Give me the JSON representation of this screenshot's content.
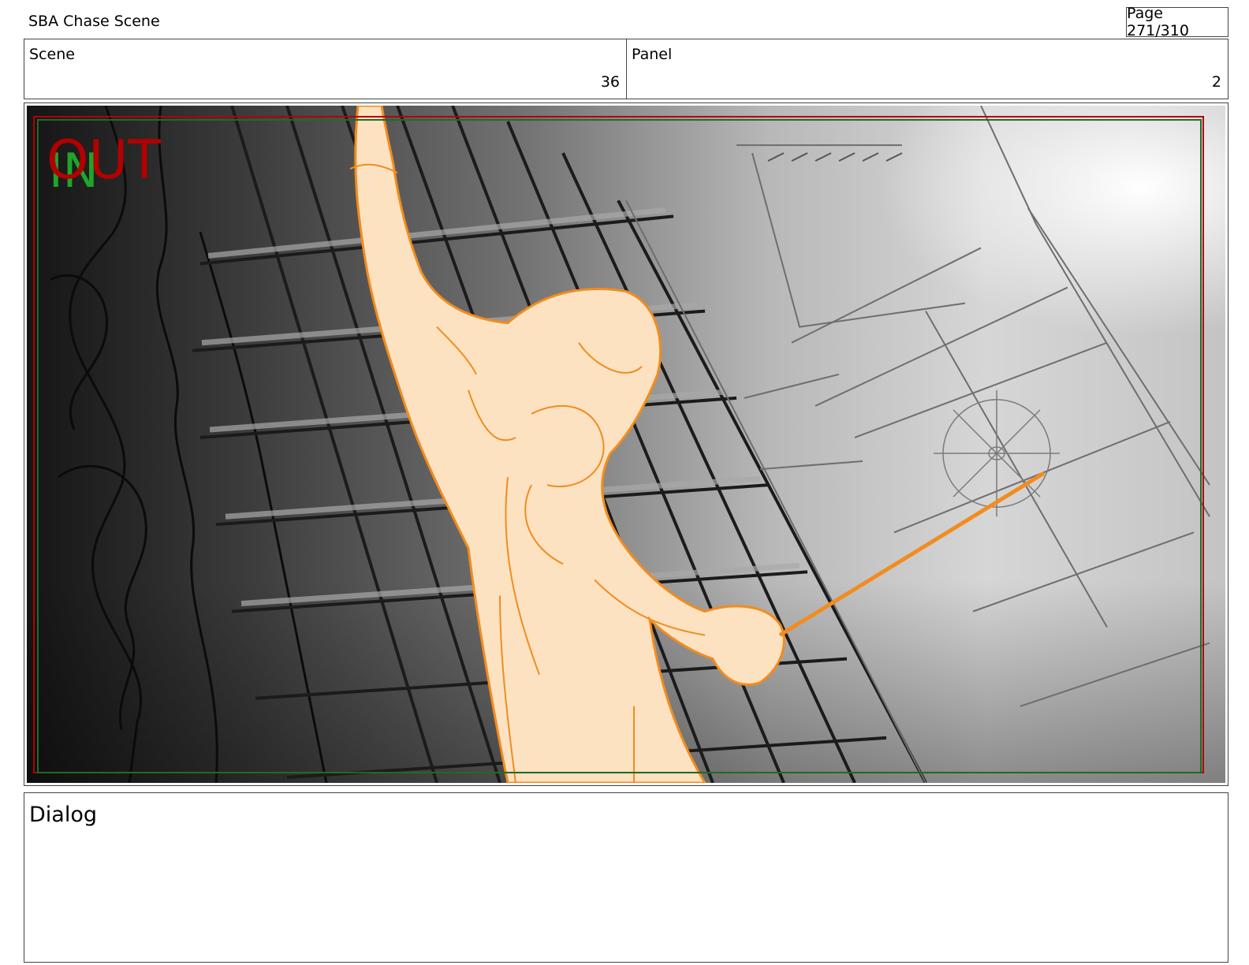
{
  "header": {
    "project_title": "SBA Chase Scene",
    "page_indicator": "Page 271/310"
  },
  "info": {
    "scene_label": "Scene",
    "scene_value": "36",
    "panel_label": "Panel",
    "panel_value": "2"
  },
  "frame": {
    "in_marker": "IN",
    "out_marker": "OUT",
    "in_color": "#1fa52a",
    "out_color": "#b30000",
    "figure_color": "#f28c1e"
  },
  "dialog": {
    "label": "Dialog"
  }
}
